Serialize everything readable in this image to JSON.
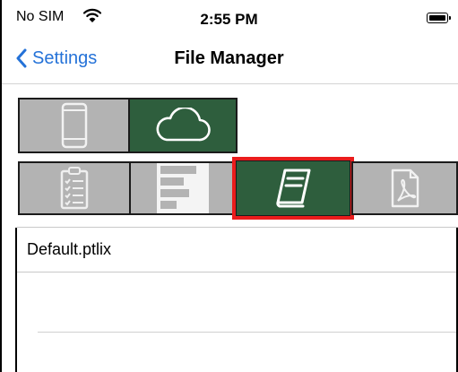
{
  "status_bar": {
    "carrier": "No SIM",
    "time": "2:55 PM"
  },
  "nav": {
    "back_label": "Settings",
    "title": "File Manager"
  },
  "storage_tabs": [
    {
      "icon": "phone-icon",
      "selected": false
    },
    {
      "icon": "cloud-icon",
      "selected": true
    }
  ],
  "type_tabs": [
    {
      "icon": "clipboard-checklist-icon",
      "selected": false
    },
    {
      "icon": "report-icon",
      "selected": false
    },
    {
      "icon": "book-icon",
      "selected": true,
      "highlighted": true
    },
    {
      "icon": "pdf-icon",
      "selected": false
    }
  ],
  "files": [
    {
      "name": "Default.ptlix"
    }
  ],
  "colors": {
    "accent": "#2472d8",
    "selected_tab": "#2e5e3d",
    "unselected_tab": "#b3b3b3",
    "highlight": "#ea1c1c"
  }
}
